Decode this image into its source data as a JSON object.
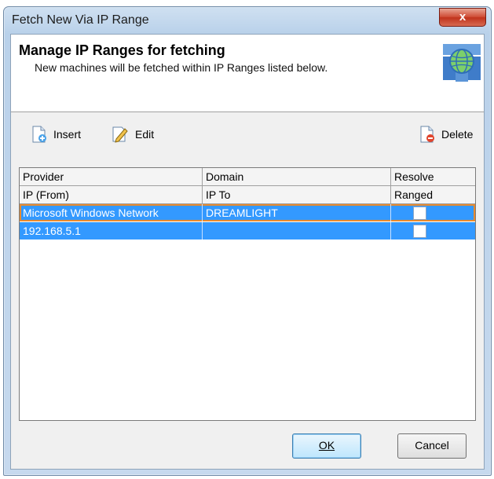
{
  "window": {
    "title": "Fetch New Via IP Range",
    "close_glyph": "x"
  },
  "header": {
    "title": "Manage IP Ranges for fetching",
    "subtitle": "New machines will be fetched within IP Ranges listed below.",
    "icon": "network-globe-icon"
  },
  "toolbar": {
    "insert": {
      "label": "Insert",
      "icon": "insert-icon"
    },
    "edit": {
      "label": "Edit",
      "icon": "edit-icon"
    },
    "delete": {
      "label": "Delete",
      "icon": "delete-icon"
    }
  },
  "grid": {
    "header_row1": [
      "Provider",
      "Domain",
      "Resolve"
    ],
    "header_row2": [
      "IP (From)",
      "IP To",
      "Ranged"
    ],
    "rows": [
      {
        "col1": "Microsoft Windows Network",
        "col2": "DREAMLIGHT",
        "checked": false
      },
      {
        "col1": "192.168.5.1",
        "col2": "",
        "checked": false
      }
    ],
    "selection_color": "#3399ff"
  },
  "buttons": {
    "ok": "OK",
    "cancel": "Cancel"
  }
}
